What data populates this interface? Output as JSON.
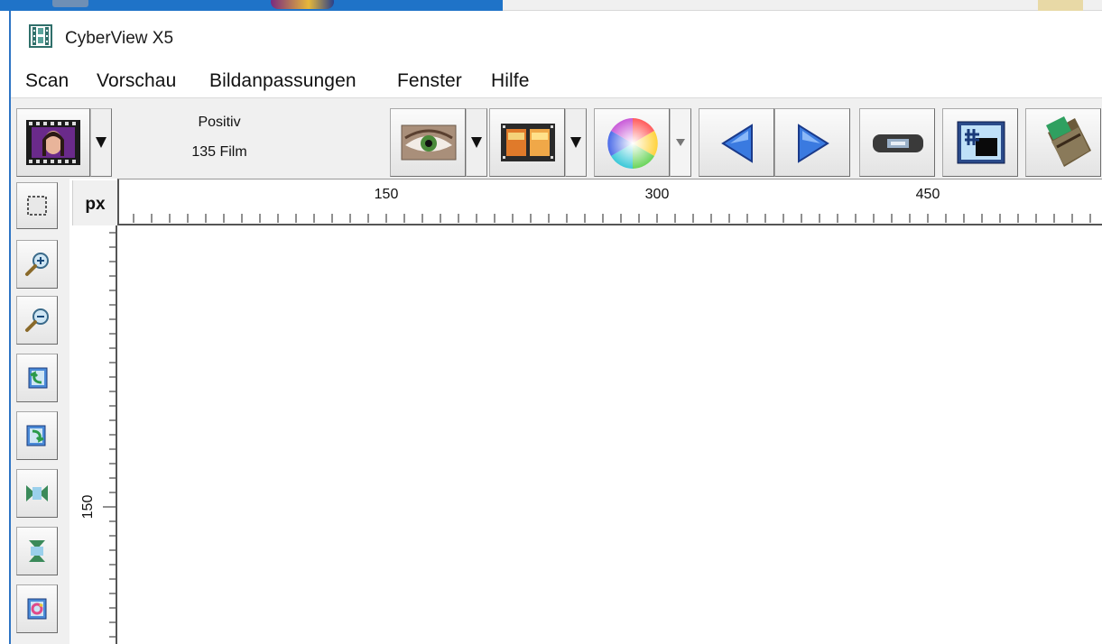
{
  "window": {
    "title": "CyberView X5",
    "app_icon": "film-strip-icon"
  },
  "menu": {
    "items": [
      {
        "label": "Scan"
      },
      {
        "label": "Vorschau"
      },
      {
        "label": "Bildanpassungen"
      },
      {
        "label": "Fenster"
      },
      {
        "label": "Hilfe"
      }
    ]
  },
  "toolbar": {
    "mode_line1": "Positiv",
    "mode_line2": "135 Film",
    "buttons": [
      {
        "icon": "portrait-film-icon"
      },
      {
        "icon": "eye-preview-icon"
      },
      {
        "icon": "film-frame-icon"
      },
      {
        "icon": "color-wheel-icon"
      },
      {
        "icon": "arrow-left-icon"
      },
      {
        "icon": "arrow-right-icon"
      },
      {
        "icon": "film-holder-icon"
      },
      {
        "icon": "sharpen-grid-icon"
      },
      {
        "icon": "scanner-icon"
      }
    ]
  },
  "tools": [
    {
      "icon": "select-rectangle-icon"
    },
    {
      "icon": "zoom-in-icon"
    },
    {
      "icon": "zoom-out-icon"
    },
    {
      "icon": "rotate-left-icon"
    },
    {
      "icon": "rotate-right-icon"
    },
    {
      "icon": "flip-horizontal-icon"
    },
    {
      "icon": "flip-vertical-icon"
    },
    {
      "icon": "reset-rotation-icon"
    }
  ],
  "ruler": {
    "unit": "px",
    "h_labels": [
      "150",
      "300",
      "450"
    ],
    "v_labels": [
      "150"
    ]
  },
  "colors": {
    "accent_blue": "#2d74c4",
    "toolbar_bg": "#f0f0f0"
  }
}
